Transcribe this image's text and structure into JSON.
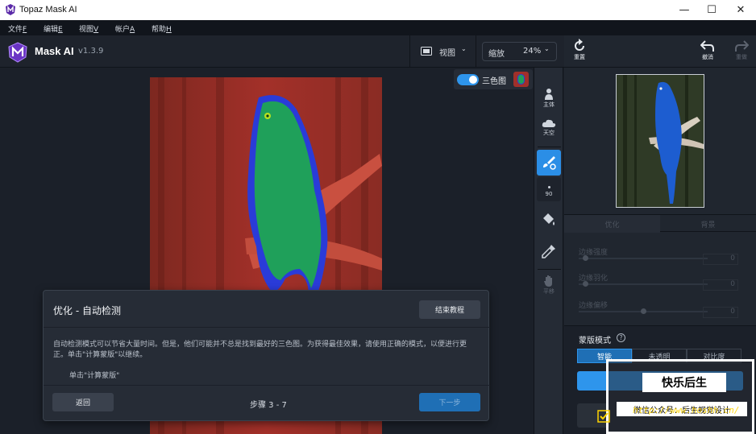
{
  "window": {
    "title": "Topaz Mask AI"
  },
  "menu": [
    {
      "label": "文件",
      "key": "F"
    },
    {
      "label": "编辑",
      "key": "E"
    },
    {
      "label": "视图",
      "key": "V"
    },
    {
      "label": "帐户",
      "key": "A"
    },
    {
      "label": "帮助",
      "key": "H"
    }
  ],
  "toolbar": {
    "brand": "Mask AI",
    "version": "v1.3.9",
    "view_label": "视图",
    "zoom_label": "缩放",
    "zoom_value": "24%"
  },
  "trimap": {
    "label": "三色图",
    "enabled": true
  },
  "tools": {
    "subject": "主体",
    "sky": "天空",
    "brush_size": "90",
    "pan": "平移"
  },
  "right_panel": {
    "reset": "重置",
    "undo": "撤消",
    "redo": "重做",
    "tabs": [
      "优化",
      "背景"
    ],
    "sliders": [
      {
        "label": "边缘强度",
        "value": "0",
        "level": 0.05
      },
      {
        "label": "边缘羽化",
        "value": "0",
        "level": 0.05
      },
      {
        "label": "边缘偏移",
        "value": "0",
        "level": 0.5
      }
    ],
    "mask_mode_label": "蒙版模式",
    "mask_modes": [
      "智能",
      "未透明",
      "对比度"
    ]
  },
  "dialog": {
    "title": "优化 - 自动检测",
    "end_button": "结束教程",
    "body": "自动检测模式可以节省大量时间。但是，他们可能并不总是找到最好的三色图。为获得最佳效果，请使用正确的模式，以便进行更正。单击\"计算蒙版\"以继续。",
    "hint": "单击\"计算蒙版\"",
    "back_button": "返回",
    "step": "步骤 3 - 7",
    "next_button": "下一步"
  },
  "watermark": {
    "title": "快乐后生",
    "subtitle": "微信公众号：后生视觉设计",
    "url": "http://www.hoshh.cn/"
  },
  "colors": {
    "accent": "#2e95ec",
    "trimap_background": "#a0302a",
    "trimap_foreground": "#1fa05a",
    "trimap_edge": "#2a3bd8"
  }
}
